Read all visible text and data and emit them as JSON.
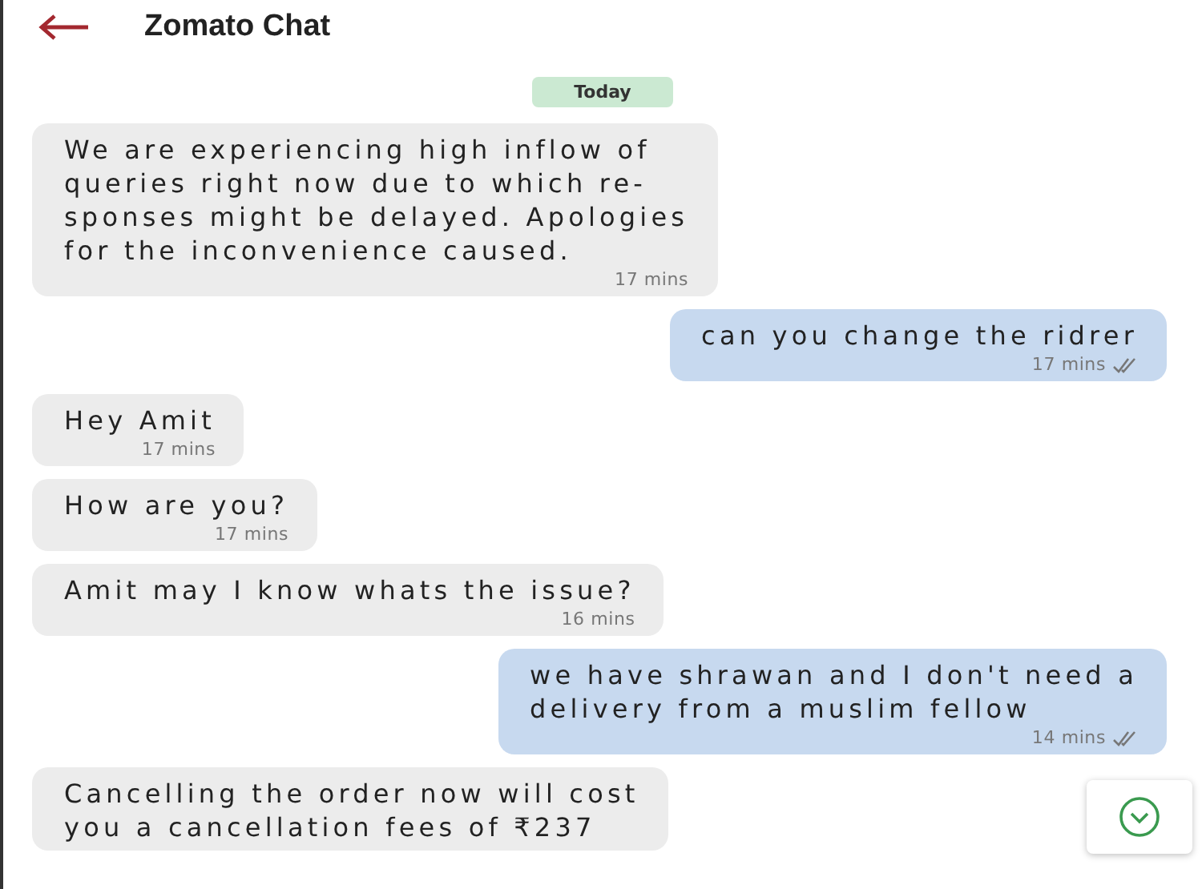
{
  "header": {
    "title": "Zomato Chat"
  },
  "date_chip": "Today",
  "messages": [
    {
      "kind": "incoming",
      "text": "We are experiencing high inflow of\nqueries right now due to which re-\nsponses might be delayed. Apologies\nfor the inconvenience caused.",
      "time": "17 mins"
    },
    {
      "kind": "outgoing",
      "text": "can you change the ridrer",
      "time": "17 mins"
    },
    {
      "kind": "incoming",
      "text": "Hey Amit",
      "time": "17 mins"
    },
    {
      "kind": "incoming",
      "text": "How are you?",
      "time": "17 mins"
    },
    {
      "kind": "incoming",
      "text": "Amit may I know whats the issue?",
      "time": "16 mins"
    },
    {
      "kind": "outgoing",
      "text": "we have shrawan and I don't need a\ndelivery from a muslim fellow",
      "time": "14 mins"
    },
    {
      "kind": "incoming",
      "text": "Cancelling the order now will cost\nyou a cancellation fees of ₹237"
    }
  ]
}
